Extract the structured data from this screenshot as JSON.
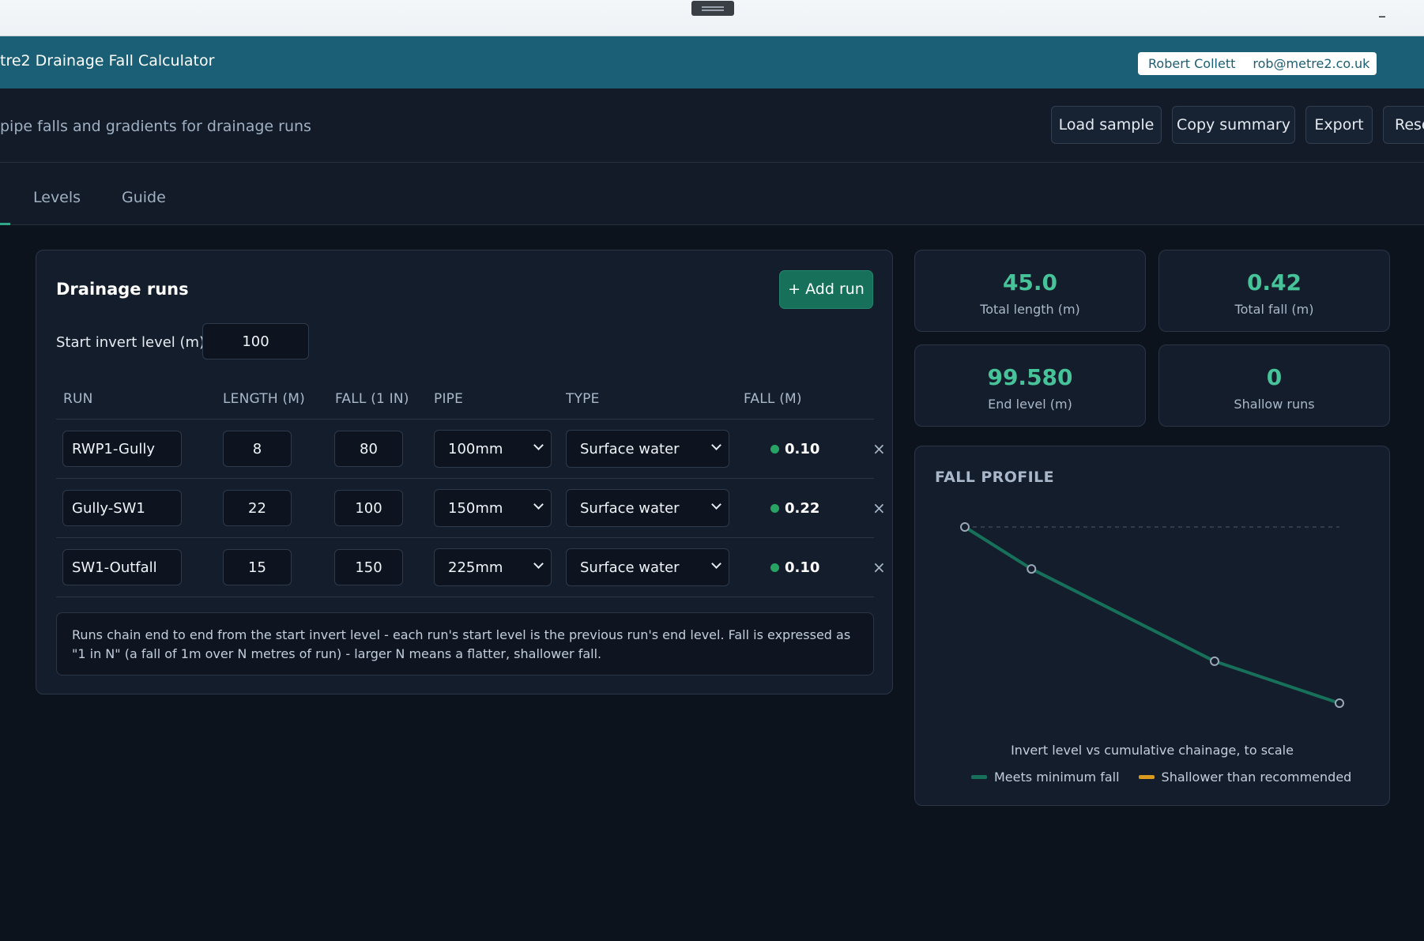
{
  "app": {
    "title": "tre2 Drainage Fall Calculator",
    "user_name": "Robert Collett",
    "user_email": "rob@metre2.co.uk"
  },
  "subheader": {
    "subtitle": "pipe falls and gradients for drainage runs",
    "buttons": {
      "load_sample": "Load sample",
      "copy_summary": "Copy summary",
      "export": "Export",
      "reset": "Rese"
    }
  },
  "tabs": [
    "Levels",
    "Guide"
  ],
  "runs_panel": {
    "title": "Drainage runs",
    "add_button": "+ Add run",
    "start_level_label": "Start invert level (m)",
    "start_level_value": "100",
    "columns": [
      "RUN",
      "LENGTH (M)",
      "FALL (1 IN)",
      "PIPE",
      "TYPE",
      "FALL (M)"
    ],
    "rows": [
      {
        "run": "RWP1-Gully",
        "length": "8",
        "fall_in": "80",
        "pipe": "100mm",
        "type": "Surface water",
        "fall_m": "0.10"
      },
      {
        "run": "Gully-SW1",
        "length": "22",
        "fall_in": "100",
        "pipe": "150mm",
        "type": "Surface water",
        "fall_m": "0.22"
      },
      {
        "run": "SW1-Outfall",
        "length": "15",
        "fall_in": "150",
        "pipe": "225mm",
        "type": "Surface water",
        "fall_m": "0.10"
      }
    ],
    "remove_symbol": "×",
    "note": "Runs chain end to end from the start invert level - each run's start level is the previous run's end level. Fall is expressed as \"1 in N\" (a fall of 1m over N metres of run) - larger N means a flatter, shallower fall."
  },
  "stats": {
    "total_length": {
      "value": "45.0",
      "label": "Total length (m)"
    },
    "total_fall": {
      "value": "0.42",
      "label": "Total fall (m)"
    },
    "end_level": {
      "value": "99.580",
      "label": "End level (m)"
    },
    "shallow_runs": {
      "value": "0",
      "label": "Shallow runs"
    }
  },
  "profile": {
    "title": "FALL PROFILE",
    "caption": "Invert level vs cumulative chainage, to scale",
    "legend": [
      "Meets minimum fall",
      "Shallower than recommended"
    ],
    "colors": {
      "ok": "#17715a",
      "shallow": "#d99a1e"
    }
  },
  "chart_data": {
    "type": "line",
    "x": [
      0,
      8,
      30,
      45
    ],
    "y": [
      100,
      99.9,
      99.68,
      99.58
    ],
    "xlabel": "",
    "ylabel": "",
    "ylim": [
      99.58,
      100
    ]
  },
  "colors": {
    "header": "#1a5f75",
    "accent": "#47c39a",
    "ok_dot": "#27a463"
  }
}
